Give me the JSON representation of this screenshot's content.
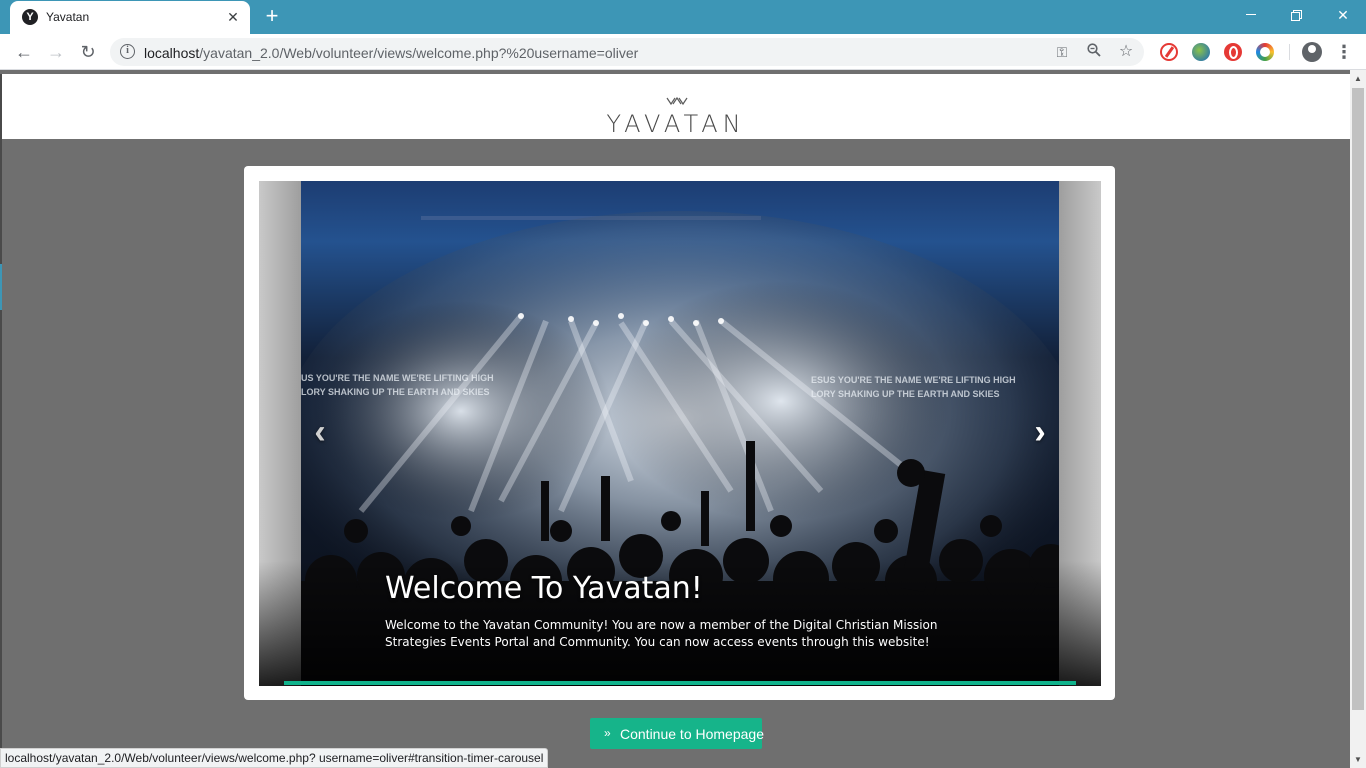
{
  "browser": {
    "tab_title": "Yavatan",
    "tab_favicon_letter": "Y",
    "url_host": "localhost",
    "url_path": "/yavatan_2.0/Web/volunteer/views/welcome.php?%20username=oliver",
    "status_url": "localhost/yavatan_2.0/Web/volunteer/views/welcome.php? username=oliver#transition-timer-carousel",
    "icons": {
      "back": "arrow-left-icon",
      "forward": "arrow-right-icon",
      "reload": "reload-icon",
      "info": "info-icon",
      "key": "key-icon",
      "zoom": "zoom-icon",
      "star": "star-icon",
      "profile": "account-icon",
      "menu": "more-vert-icon"
    }
  },
  "site": {
    "logo_text": "YAVATAN"
  },
  "carousel": {
    "slide_title": "Welcome To Yavatan!",
    "slide_text": "Welcome to the Yavatan Community! You are now a member of the Digital Christian Mission Strategies Events Portal and Community. You can now access events through this website!",
    "prev_glyph": "‹",
    "next_glyph": "›",
    "timer_color": "#10b38c"
  },
  "actions": {
    "continue_label": "Continue to Homepage",
    "continue_glyph": "»",
    "button_color": "#16b48a"
  },
  "colors": {
    "titlebar": "#3d96b6",
    "page_background": "#6f6f6f"
  }
}
